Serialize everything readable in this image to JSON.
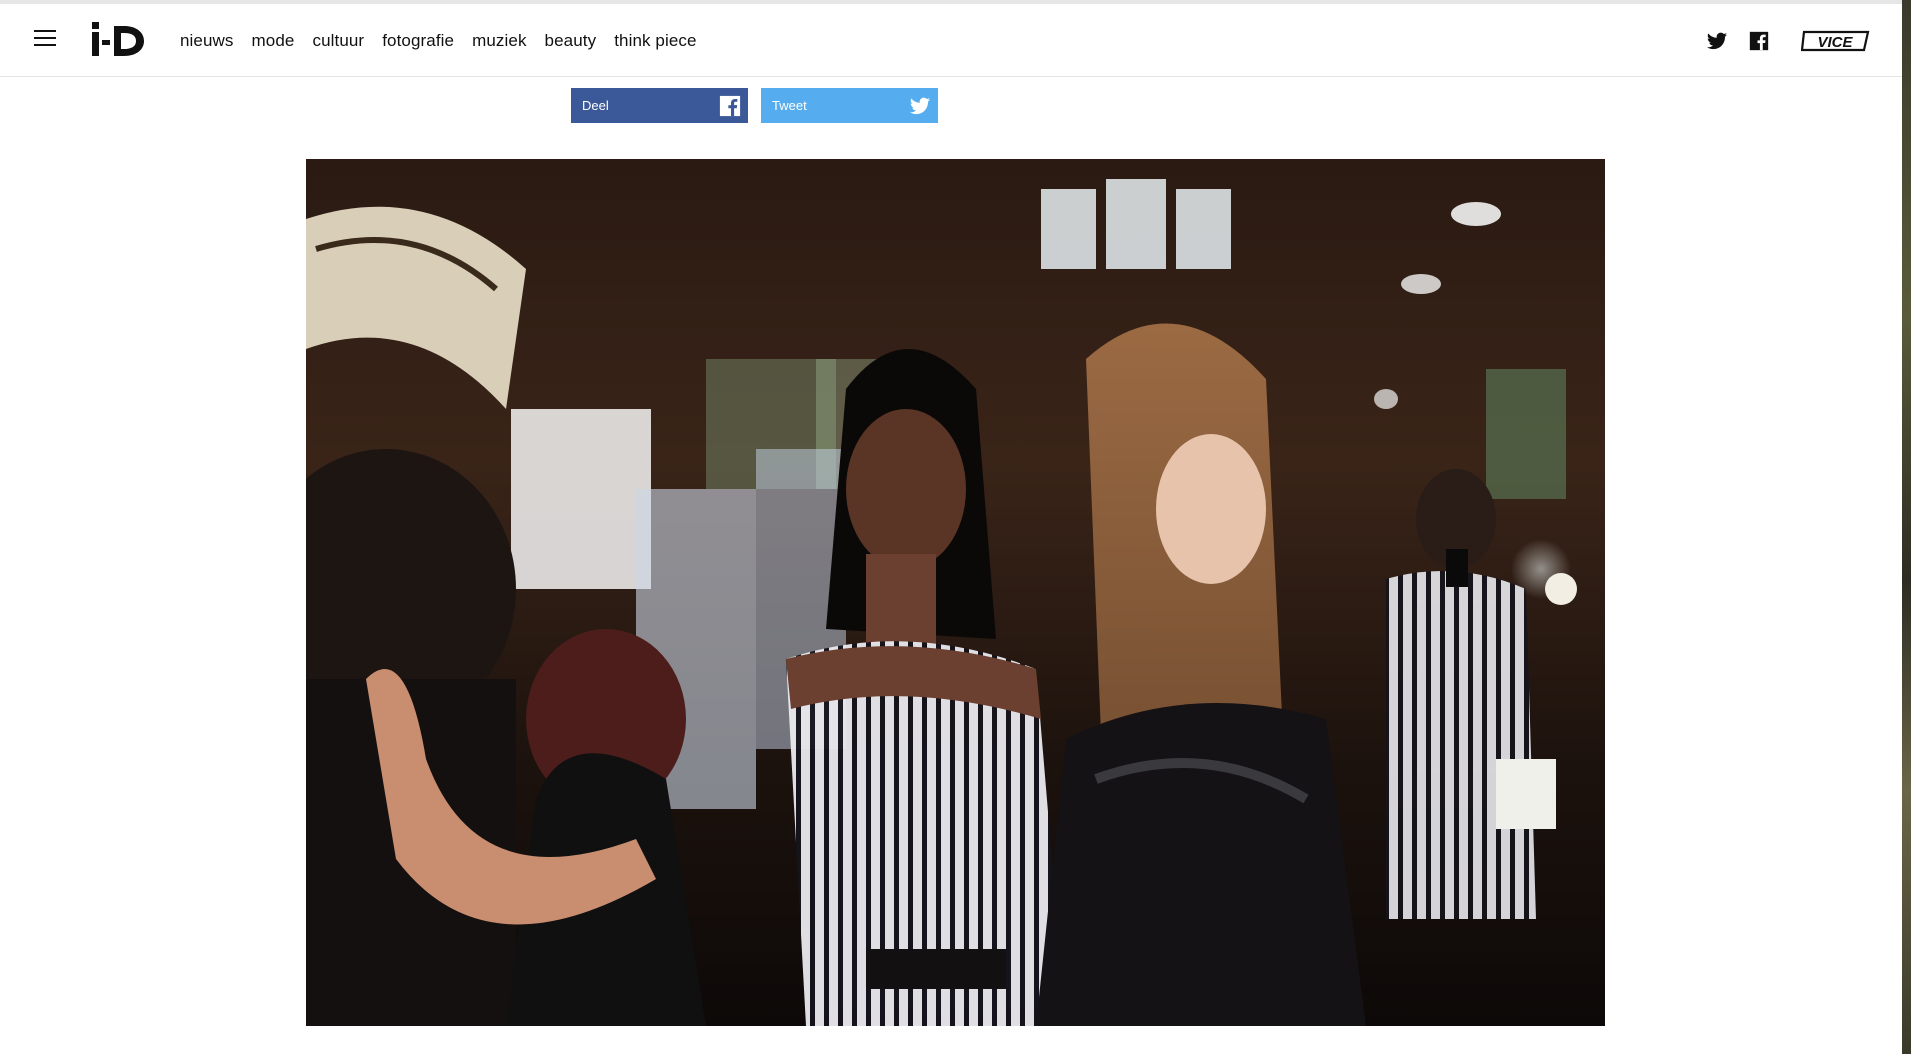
{
  "header": {
    "logo_text": "i-D",
    "nav": [
      "nieuws",
      "mode",
      "cultuur",
      "fotografie",
      "muziek",
      "beauty",
      "think piece"
    ],
    "vice_logo_text": "VICE"
  },
  "share": {
    "facebook_label": "Deel",
    "twitter_label": "Tweet"
  },
  "icons": {
    "menu": "hamburger-icon",
    "twitter": "twitter-icon",
    "facebook": "facebook-icon"
  },
  "colors": {
    "facebook_blue": "#3b5998",
    "twitter_blue": "#55acee",
    "text": "#111111"
  }
}
